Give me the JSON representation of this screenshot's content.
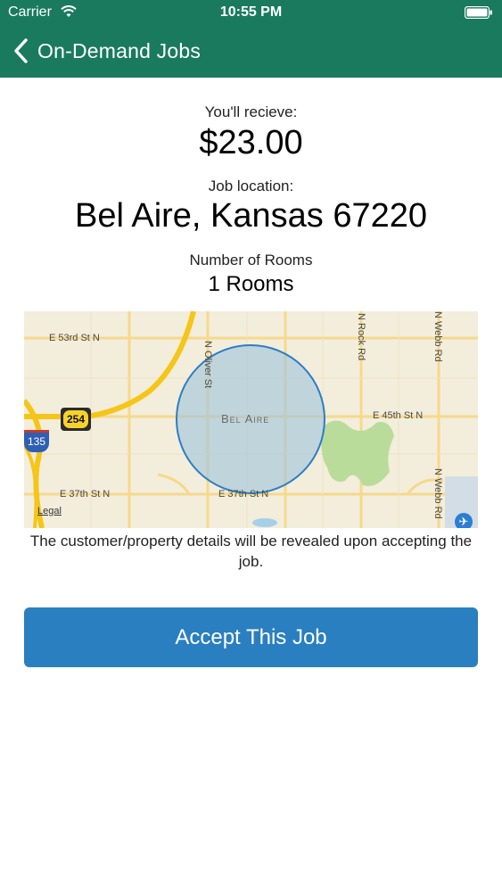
{
  "status_bar": {
    "carrier": "Carrier",
    "time": "10:55 PM"
  },
  "nav": {
    "back_label": "On-Demand Jobs"
  },
  "job": {
    "receive_label": "You'll recieve:",
    "amount": "$23.00",
    "location_label": "Job location:",
    "location": "Bel Aire, Kansas 67220",
    "rooms_label": "Number of Rooms",
    "rooms": "1 Rooms"
  },
  "map": {
    "city": "Bel Aire",
    "streets": {
      "e53rd": "E 53rd St N",
      "e45th": "E 45th St N",
      "e37th_west": "E 37th St N",
      "e37th_center": "E 37th St N",
      "oliver": "N Oliver St",
      "rock": "N Rock Rd",
      "webb_top": "N Webb Rd",
      "webb_bottom": "N Webb Rd"
    },
    "route_254": "254",
    "route_135": "135",
    "legal": "Legal"
  },
  "disclaimer": "The customer/property details will be revealed upon accepting the job.",
  "accept_button": "Accept This Job",
  "colors": {
    "header": "#1a7a5e",
    "button": "#2a7fc0",
    "radius_circle": "#2d7ec2"
  }
}
